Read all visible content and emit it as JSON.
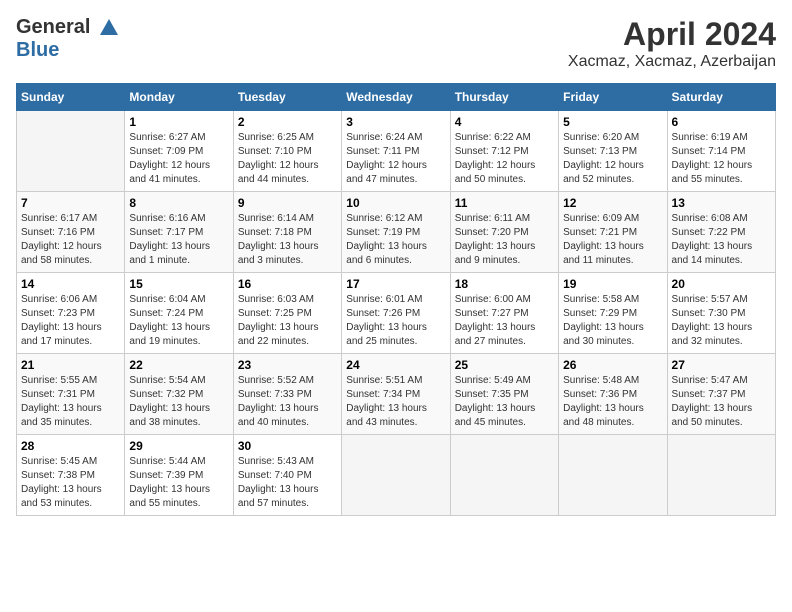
{
  "logo": {
    "line1": "General",
    "line2": "Blue"
  },
  "title": "April 2024",
  "subtitle": "Xacmaz, Xacmaz, Azerbaijan",
  "weekdays": [
    "Sunday",
    "Monday",
    "Tuesday",
    "Wednesday",
    "Thursday",
    "Friday",
    "Saturday"
  ],
  "weeks": [
    [
      {
        "day": "",
        "sunrise": "",
        "sunset": "",
        "daylight": ""
      },
      {
        "day": "1",
        "sunrise": "Sunrise: 6:27 AM",
        "sunset": "Sunset: 7:09 PM",
        "daylight": "Daylight: 12 hours and 41 minutes."
      },
      {
        "day": "2",
        "sunrise": "Sunrise: 6:25 AM",
        "sunset": "Sunset: 7:10 PM",
        "daylight": "Daylight: 12 hours and 44 minutes."
      },
      {
        "day": "3",
        "sunrise": "Sunrise: 6:24 AM",
        "sunset": "Sunset: 7:11 PM",
        "daylight": "Daylight: 12 hours and 47 minutes."
      },
      {
        "day": "4",
        "sunrise": "Sunrise: 6:22 AM",
        "sunset": "Sunset: 7:12 PM",
        "daylight": "Daylight: 12 hours and 50 minutes."
      },
      {
        "day": "5",
        "sunrise": "Sunrise: 6:20 AM",
        "sunset": "Sunset: 7:13 PM",
        "daylight": "Daylight: 12 hours and 52 minutes."
      },
      {
        "day": "6",
        "sunrise": "Sunrise: 6:19 AM",
        "sunset": "Sunset: 7:14 PM",
        "daylight": "Daylight: 12 hours and 55 minutes."
      }
    ],
    [
      {
        "day": "7",
        "sunrise": "Sunrise: 6:17 AM",
        "sunset": "Sunset: 7:16 PM",
        "daylight": "Daylight: 12 hours and 58 minutes."
      },
      {
        "day": "8",
        "sunrise": "Sunrise: 6:16 AM",
        "sunset": "Sunset: 7:17 PM",
        "daylight": "Daylight: 13 hours and 1 minute."
      },
      {
        "day": "9",
        "sunrise": "Sunrise: 6:14 AM",
        "sunset": "Sunset: 7:18 PM",
        "daylight": "Daylight: 13 hours and 3 minutes."
      },
      {
        "day": "10",
        "sunrise": "Sunrise: 6:12 AM",
        "sunset": "Sunset: 7:19 PM",
        "daylight": "Daylight: 13 hours and 6 minutes."
      },
      {
        "day": "11",
        "sunrise": "Sunrise: 6:11 AM",
        "sunset": "Sunset: 7:20 PM",
        "daylight": "Daylight: 13 hours and 9 minutes."
      },
      {
        "day": "12",
        "sunrise": "Sunrise: 6:09 AM",
        "sunset": "Sunset: 7:21 PM",
        "daylight": "Daylight: 13 hours and 11 minutes."
      },
      {
        "day": "13",
        "sunrise": "Sunrise: 6:08 AM",
        "sunset": "Sunset: 7:22 PM",
        "daylight": "Daylight: 13 hours and 14 minutes."
      }
    ],
    [
      {
        "day": "14",
        "sunrise": "Sunrise: 6:06 AM",
        "sunset": "Sunset: 7:23 PM",
        "daylight": "Daylight: 13 hours and 17 minutes."
      },
      {
        "day": "15",
        "sunrise": "Sunrise: 6:04 AM",
        "sunset": "Sunset: 7:24 PM",
        "daylight": "Daylight: 13 hours and 19 minutes."
      },
      {
        "day": "16",
        "sunrise": "Sunrise: 6:03 AM",
        "sunset": "Sunset: 7:25 PM",
        "daylight": "Daylight: 13 hours and 22 minutes."
      },
      {
        "day": "17",
        "sunrise": "Sunrise: 6:01 AM",
        "sunset": "Sunset: 7:26 PM",
        "daylight": "Daylight: 13 hours and 25 minutes."
      },
      {
        "day": "18",
        "sunrise": "Sunrise: 6:00 AM",
        "sunset": "Sunset: 7:27 PM",
        "daylight": "Daylight: 13 hours and 27 minutes."
      },
      {
        "day": "19",
        "sunrise": "Sunrise: 5:58 AM",
        "sunset": "Sunset: 7:29 PM",
        "daylight": "Daylight: 13 hours and 30 minutes."
      },
      {
        "day": "20",
        "sunrise": "Sunrise: 5:57 AM",
        "sunset": "Sunset: 7:30 PM",
        "daylight": "Daylight: 13 hours and 32 minutes."
      }
    ],
    [
      {
        "day": "21",
        "sunrise": "Sunrise: 5:55 AM",
        "sunset": "Sunset: 7:31 PM",
        "daylight": "Daylight: 13 hours and 35 minutes."
      },
      {
        "day": "22",
        "sunrise": "Sunrise: 5:54 AM",
        "sunset": "Sunset: 7:32 PM",
        "daylight": "Daylight: 13 hours and 38 minutes."
      },
      {
        "day": "23",
        "sunrise": "Sunrise: 5:52 AM",
        "sunset": "Sunset: 7:33 PM",
        "daylight": "Daylight: 13 hours and 40 minutes."
      },
      {
        "day": "24",
        "sunrise": "Sunrise: 5:51 AM",
        "sunset": "Sunset: 7:34 PM",
        "daylight": "Daylight: 13 hours and 43 minutes."
      },
      {
        "day": "25",
        "sunrise": "Sunrise: 5:49 AM",
        "sunset": "Sunset: 7:35 PM",
        "daylight": "Daylight: 13 hours and 45 minutes."
      },
      {
        "day": "26",
        "sunrise": "Sunrise: 5:48 AM",
        "sunset": "Sunset: 7:36 PM",
        "daylight": "Daylight: 13 hours and 48 minutes."
      },
      {
        "day": "27",
        "sunrise": "Sunrise: 5:47 AM",
        "sunset": "Sunset: 7:37 PM",
        "daylight": "Daylight: 13 hours and 50 minutes."
      }
    ],
    [
      {
        "day": "28",
        "sunrise": "Sunrise: 5:45 AM",
        "sunset": "Sunset: 7:38 PM",
        "daylight": "Daylight: 13 hours and 53 minutes."
      },
      {
        "day": "29",
        "sunrise": "Sunrise: 5:44 AM",
        "sunset": "Sunset: 7:39 PM",
        "daylight": "Daylight: 13 hours and 55 minutes."
      },
      {
        "day": "30",
        "sunrise": "Sunrise: 5:43 AM",
        "sunset": "Sunset: 7:40 PM",
        "daylight": "Daylight: 13 hours and 57 minutes."
      },
      {
        "day": "",
        "sunrise": "",
        "sunset": "",
        "daylight": ""
      },
      {
        "day": "",
        "sunrise": "",
        "sunset": "",
        "daylight": ""
      },
      {
        "day": "",
        "sunrise": "",
        "sunset": "",
        "daylight": ""
      },
      {
        "day": "",
        "sunrise": "",
        "sunset": "",
        "daylight": ""
      }
    ]
  ]
}
